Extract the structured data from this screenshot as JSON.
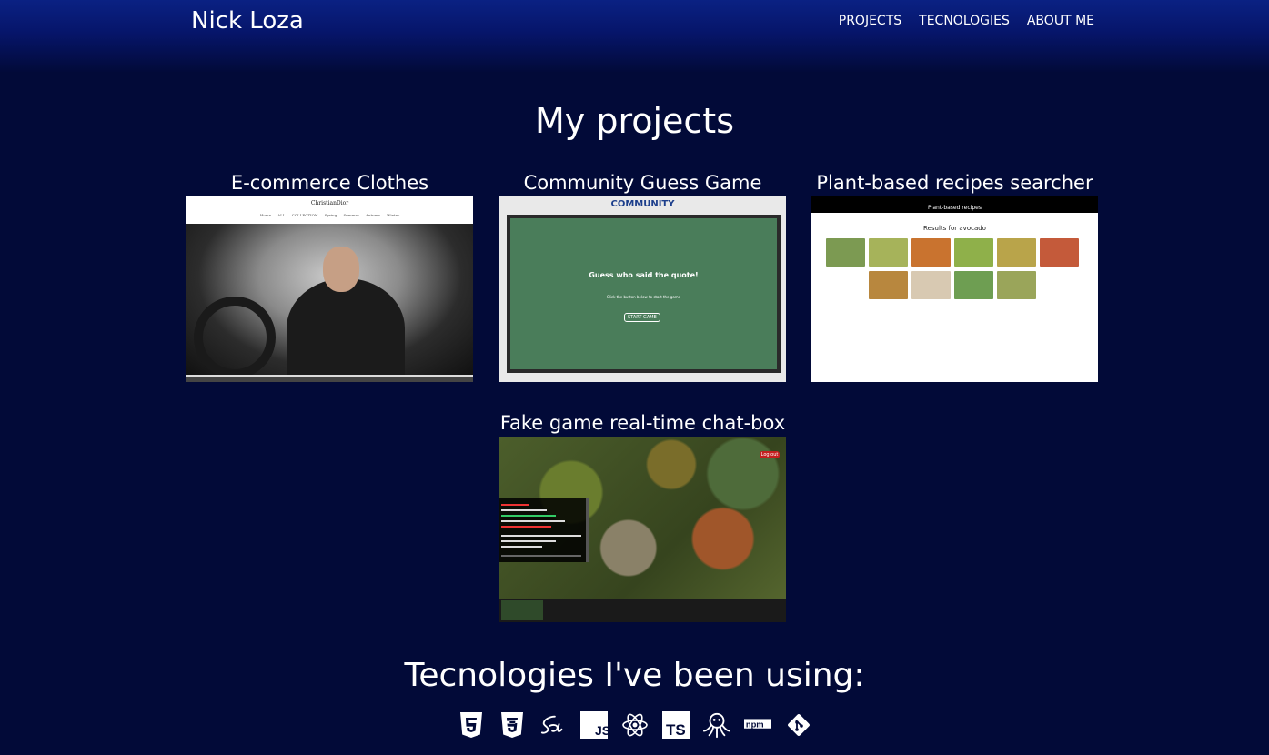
{
  "header": {
    "brand": "Nick Loza",
    "nav": [
      "PROJECTS",
      "TECNOLOGIES",
      "ABOUT ME"
    ]
  },
  "projects_section": {
    "title": "My projects",
    "cards": [
      {
        "title": "E-commerce Clothes",
        "screenshot": {
          "logo": "ChristianDior",
          "menu": "Home ALL COLLECTION Spring Summer Autumn Winter"
        }
      },
      {
        "title": "Community Guess Game",
        "screenshot": {
          "logo": "COMMUNITY",
          "question": "Guess who said the quote!",
          "instruction": "Click the button below to start the game",
          "button": "START GAME"
        }
      },
      {
        "title": "Plant-based recipes searcher",
        "screenshot": {
          "app_title": "Plant-based recipes",
          "results": "Results for avocado"
        }
      },
      {
        "title": "Fake game real-time chat-box",
        "screenshot": {
          "logout": "Log out"
        }
      }
    ]
  },
  "tech_section": {
    "title": "Tecnologies I've been using:",
    "icons": [
      "html5-icon",
      "css3-icon",
      "sass-icon",
      "javascript-icon",
      "react-icon",
      "typescript-icon",
      "octopus-icon",
      "npm-icon",
      "git-icon"
    ],
    "js_label": "JS",
    "ts_label": "TS",
    "npm_label": "npm"
  },
  "colors": {
    "background": "#020a38",
    "header_top": "#0a2183",
    "text": "#ffffff"
  }
}
